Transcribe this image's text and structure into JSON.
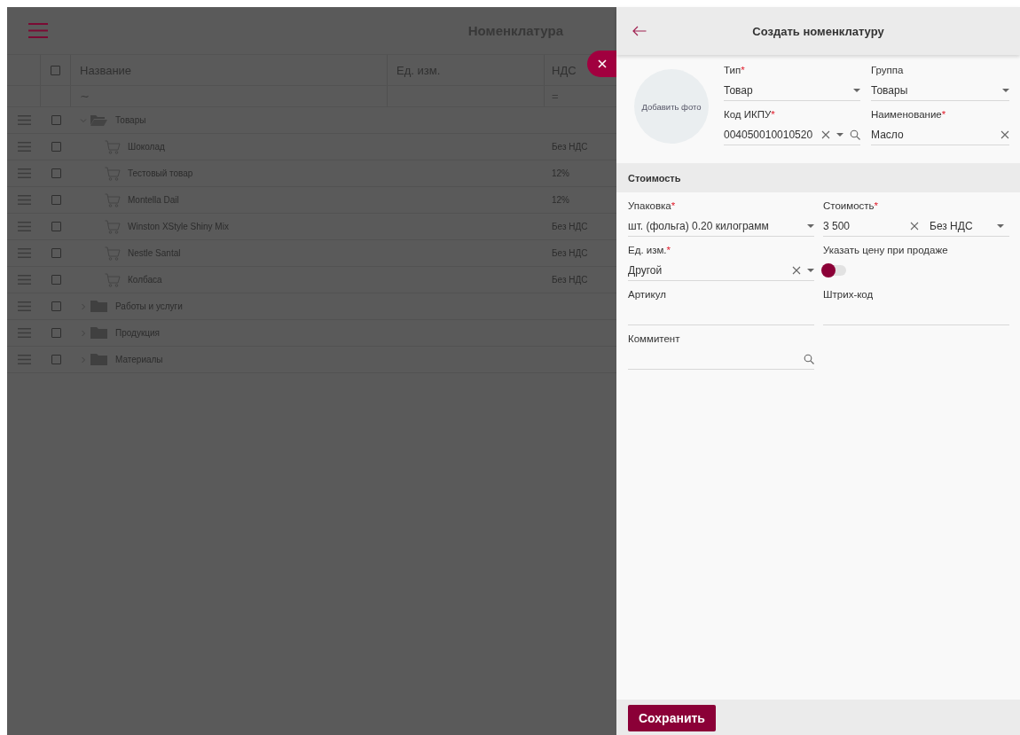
{
  "list": {
    "title": "Номенклатура",
    "all_checked": false,
    "columns": [
      {
        "label": "Название",
        "filter": "∼"
      },
      {
        "label": "Ед. изм."
      },
      {
        "label": "НДС",
        "filter": "="
      }
    ],
    "rows": [
      {
        "kind": "folder",
        "name": "Товары",
        "checked": false,
        "expanded": true,
        "children": [
          {
            "kind": "item",
            "name": "Шоколад",
            "vat": "Без НДС",
            "checked": false
          },
          {
            "kind": "item",
            "name": "Тестовый товар",
            "vat": "12%",
            "checked": false
          },
          {
            "kind": "item",
            "name": "Montella Dail",
            "vat": "12%",
            "checked": false
          },
          {
            "kind": "item",
            "name": "Winston XStyle Shiny Mix",
            "vat": "Без НДС",
            "checked": false
          },
          {
            "kind": "item",
            "name": "Nestle Santal",
            "vat": "Без НДС",
            "checked": false
          },
          {
            "kind": "item",
            "name": "Колбаса",
            "vat": "Без НДС",
            "checked": false
          }
        ]
      },
      {
        "kind": "folder",
        "name": "Работы и услуги",
        "checked": false,
        "expanded": false
      },
      {
        "kind": "folder",
        "name": "Продукция",
        "checked": false,
        "expanded": false
      },
      {
        "kind": "folder",
        "name": "Материалы",
        "checked": false,
        "expanded": false
      }
    ]
  },
  "panel": {
    "title": "Создать номенклатуру",
    "photo_label": "Добавить фото",
    "main_fields": [
      {
        "kind": "input",
        "label": "Тип",
        "mark": "*",
        "value": "Товар",
        "clear": false,
        "dropdown": true,
        "search": false
      },
      {
        "kind": "input",
        "label": "Группа",
        "value": "Товары",
        "clear": false,
        "dropdown": true,
        "search": false
      },
      {
        "kind": "input",
        "label": "Код ИКПУ",
        "mark": "*",
        "value": "004050010010520",
        "clear": true,
        "dropdown": true,
        "search": true
      },
      {
        "kind": "input",
        "label": "Наименование",
        "mark": "*",
        "value": "Масло",
        "clear": true,
        "dropdown": false,
        "search": false
      }
    ],
    "section": "Стоимость",
    "price_fields": [
      {
        "kind": "input",
        "label": "Упаковка",
        "mark": "*",
        "value": "шт. (фольга)  0.20 килограмм",
        "clear": false,
        "dropdown": true,
        "search": false
      },
      {
        "kind": "input",
        "label": "Стоимость",
        "mark": "*",
        "value": "3 500",
        "clear": true,
        "dropdown": false,
        "search": false,
        "vat": "Без НДС"
      },
      {
        "kind": "input",
        "label": "Ед. изм.",
        "mark": "*",
        "value": "Другой",
        "clear": true,
        "dropdown": true,
        "search": false
      },
      {
        "kind": "toggle",
        "label": "Указать цену при продаже",
        "on": false
      },
      {
        "kind": "input",
        "label": "Артикул",
        "clear": false,
        "dropdown": false,
        "search": false
      },
      {
        "kind": "input",
        "label": "Штрих-код",
        "clear": false,
        "dropdown": false,
        "search": false
      },
      {
        "kind": "input",
        "label": "Коммитент",
        "clear": false,
        "dropdown": false,
        "search": true
      }
    ],
    "save": "Сохранить"
  }
}
